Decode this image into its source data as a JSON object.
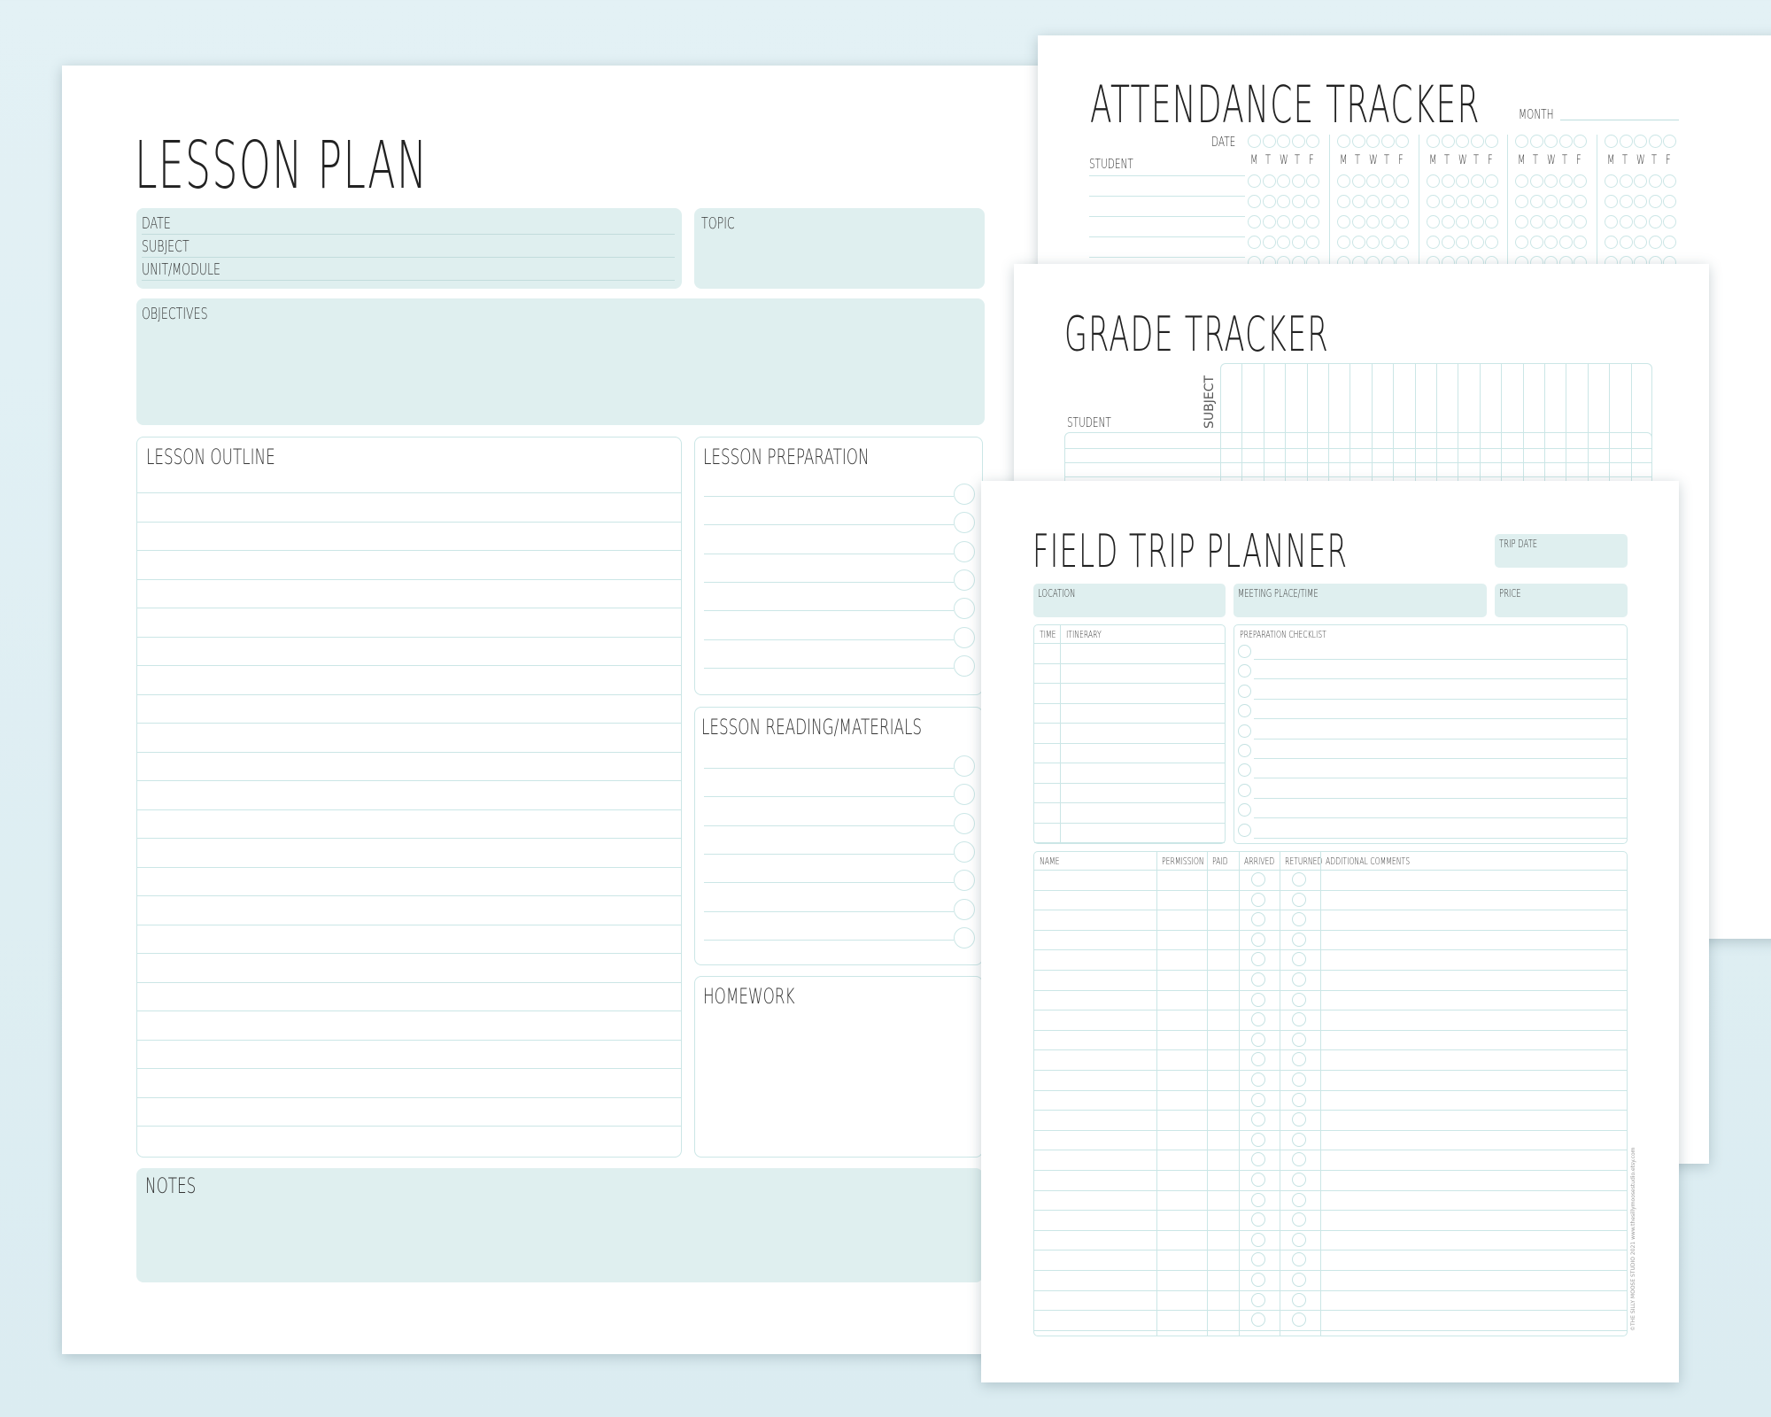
{
  "lesson_plan": {
    "title": "LESSON PLAN",
    "date_label": "DATE",
    "subject_label": "SUBJECT",
    "unit_label": "UNIT/MODULE",
    "topic_label": "TOPIC",
    "objectives_label": "OBJECTIVES",
    "outline_label": "LESSON OUTLINE",
    "preparation_label": "LESSON PREPARATION",
    "reading_label": "LESSON READING/MATERIALS",
    "homework_label": "HOMEWORK",
    "notes_label": "NOTES"
  },
  "attendance": {
    "title": "ATTENDANCE TRACKER",
    "month_label": "MONTH",
    "date_label": "DATE",
    "student_label": "STUDENT",
    "day_letters": [
      "M",
      "T",
      "W",
      "T",
      "F"
    ]
  },
  "grade": {
    "title": "GRADE TRACKER",
    "student_label": "STUDENT",
    "subject_label": "SUBJECT"
  },
  "field_trip": {
    "title": "FIELD TRIP PLANNER",
    "trip_date_label": "TRIP DATE",
    "location_label": "LOCATION",
    "meeting_label": "MEETING PLACE/TIME",
    "price_label": "PRICE",
    "time_label": "TIME",
    "itinerary_label": "ITINERARY",
    "checklist_label": "PREPARATION CHECKLIST",
    "columns": [
      "NAME",
      "PERMISSION",
      "PAID",
      "ARRIVED",
      "RETURNED",
      "ADDITIONAL COMMENTS"
    ],
    "footer": "©THE SILLY MOOSE STUDIO 2021 www.thesillymoosestudio.etsy.com"
  },
  "colors": {
    "accent_fill": "#dfefef",
    "line": "#cbe6e6",
    "background": "#e3f1f5"
  }
}
